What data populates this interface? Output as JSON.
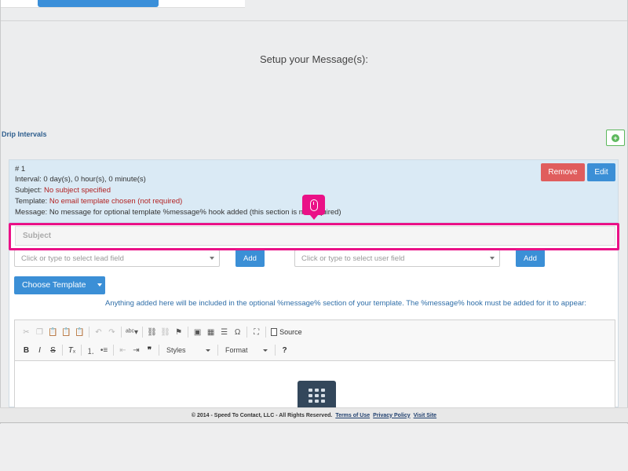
{
  "header": {
    "setup_title": "Setup your Message(s):"
  },
  "drip": {
    "section_label": "Drip Intervals",
    "add_icon": "plus-circle-icon"
  },
  "interval": {
    "number": "# 1",
    "interval_text": "Interval: 0 day(s), 0 hour(s), 0 minute(s)",
    "subject_label": "Subject: ",
    "subject_value": "No subject specified",
    "template_label": "Template: ",
    "template_value": "No email template chosen (not required)",
    "message_text": "Message: No message for optional template %message% hook added (this section is not required)",
    "remove_label": "Remove",
    "edit_label": "Edit"
  },
  "form": {
    "subject_placeholder": "Subject",
    "lead_field_placeholder": "Click or type to select lead field",
    "user_field_placeholder": "Click or type to select user field",
    "add_label": "Add",
    "choose_template_label": "Choose Template",
    "help_text": "Anything added here will be included in the optional %message% section of your template. The %message% hook must be added for it to appear:"
  },
  "editor": {
    "source_label": "Source",
    "styles_label": "Styles",
    "format_label": "Format",
    "toolbar_icons": [
      "cut-icon",
      "copy-icon",
      "paste-icon",
      "paste-text-icon",
      "paste-word-icon",
      "undo-icon",
      "redo-icon",
      "spellcheck-icon",
      "link-icon",
      "unlink-icon",
      "anchor-icon",
      "image-icon",
      "table-icon",
      "horizontal-rule-icon",
      "special-char-icon",
      "maximize-icon",
      "source-icon",
      "bold-icon",
      "italic-icon",
      "strike-icon",
      "remove-format-icon",
      "numbered-list-icon",
      "bulleted-list-icon",
      "outdent-icon",
      "indent-icon",
      "blockquote-icon",
      "help-icon"
    ],
    "center_widget_icon": "grid-icon"
  },
  "footer": {
    "copyright": "© 2014 - Speed To Contact, LLC - All Rights Reserved.",
    "terms": "Terms of Use",
    "privacy": "Privacy Policy",
    "visit": "Visit Site"
  },
  "colors": {
    "primary": "#3b8fd6",
    "danger": "#e05d5d",
    "highlight": "#ea1187",
    "success": "#5cb85c",
    "panel_head": "#daeaf5"
  }
}
